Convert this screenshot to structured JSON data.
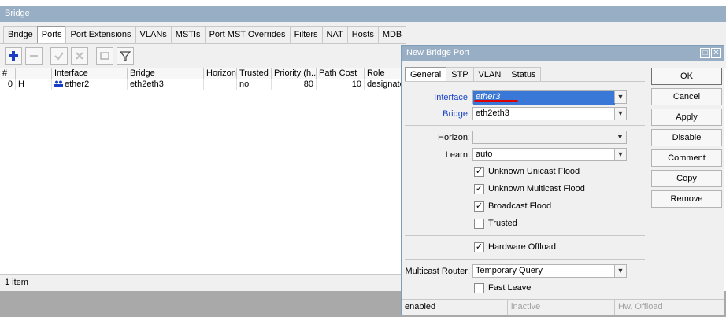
{
  "window": {
    "title": "Bridge"
  },
  "tabs": [
    "Bridge",
    "Ports",
    "Port Extensions",
    "VLANs",
    "MSTIs",
    "Port MST Overrides",
    "Filters",
    "NAT",
    "Hosts",
    "MDB"
  ],
  "active_tab": "Ports",
  "toolbar": {
    "add_icon": "plus-icon",
    "remove_icon": "minus-icon",
    "enable_icon": "check-icon",
    "disable_icon": "cross-icon",
    "comment_icon": "comment-icon",
    "filter_icon": "filter-icon"
  },
  "table": {
    "headers": [
      "#",
      "Interface",
      "Bridge",
      "Horizon",
      "Trusted",
      "Priority (h...",
      "Path Cost",
      "Role"
    ],
    "rows": [
      {
        "num": "0",
        "flag": "H",
        "interface": "ether2",
        "bridge": "eth2eth3",
        "horizon": "",
        "trusted": "no",
        "priority": "80",
        "path_cost": "10",
        "role": "designated"
      }
    ]
  },
  "status": {
    "count": "1 item"
  },
  "dialog": {
    "title": "New Bridge Port",
    "tabs": [
      "General",
      "STP",
      "VLAN",
      "Status"
    ],
    "active_tab": "General",
    "fields": {
      "interface": {
        "label": "Interface:",
        "value": "ether3"
      },
      "bridge": {
        "label": "Bridge:",
        "value": "eth2eth3"
      },
      "horizon": {
        "label": "Horizon:",
        "value": ""
      },
      "learn": {
        "label": "Learn:",
        "value": "auto"
      },
      "multicast_router": {
        "label": "Multicast Router:",
        "value": "Temporary Query"
      }
    },
    "checkboxes": {
      "unknown_unicast_flood": {
        "label": "Unknown Unicast Flood",
        "checked": true
      },
      "unknown_multicast_flood": {
        "label": "Unknown Multicast Flood",
        "checked": true
      },
      "broadcast_flood": {
        "label": "Broadcast Flood",
        "checked": true
      },
      "trusted": {
        "label": "Trusted",
        "checked": false
      },
      "hardware_offload": {
        "label": "Hardware Offload",
        "checked": true
      },
      "fast_leave": {
        "label": "Fast Leave",
        "checked": false
      }
    },
    "buttons": {
      "ok": "OK",
      "cancel": "Cancel",
      "apply": "Apply",
      "disable": "Disable",
      "comment": "Comment",
      "copy": "Copy",
      "remove": "Remove"
    },
    "status": {
      "left": "enabled",
      "middle": "inactive",
      "right": "Hw. Offload"
    }
  },
  "colors": {
    "titlebar": "#98aec4",
    "selection": "#3a78d8",
    "label_blue": "#1a44c8",
    "underline": "#dd0000"
  }
}
